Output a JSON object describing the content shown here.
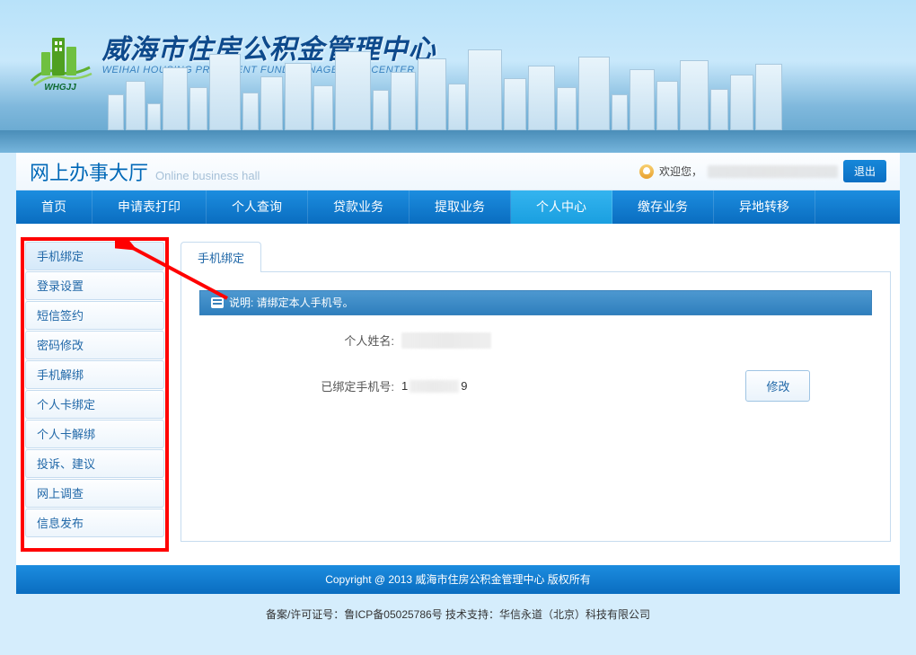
{
  "header": {
    "org_name_cn": "威海市住房公积金管理中心",
    "org_name_en": "WEIHAI HOUSING PROVIDENT FUND MANAGEMENT CENTER",
    "logo_code": "WHGJJ"
  },
  "title_bar": {
    "title_cn": "网上办事大厅",
    "title_en": "Online business hall",
    "welcome_text": "欢迎您，",
    "logout_label": "退出"
  },
  "nav": {
    "items": [
      {
        "label": "首页"
      },
      {
        "label": "申请表打印"
      },
      {
        "label": "个人查询"
      },
      {
        "label": "贷款业务"
      },
      {
        "label": "提取业务"
      },
      {
        "label": "个人中心"
      },
      {
        "label": "缴存业务"
      },
      {
        "label": "异地转移"
      }
    ],
    "active_index": 5
  },
  "sidebar": {
    "items": [
      {
        "label": "手机绑定"
      },
      {
        "label": "登录设置"
      },
      {
        "label": "短信签约"
      },
      {
        "label": "密码修改"
      },
      {
        "label": "手机解绑"
      },
      {
        "label": "个人卡绑定"
      },
      {
        "label": "个人卡解绑"
      },
      {
        "label": "投诉、建议"
      },
      {
        "label": "网上调查"
      },
      {
        "label": "信息发布"
      }
    ],
    "active_index": 0
  },
  "panel": {
    "tab_label": "手机绑定",
    "info_text": "说明: 请绑定本人手机号。",
    "name_label": "个人姓名:",
    "phone_label": "已绑定手机号:",
    "phone_prefix": "1",
    "phone_suffix": "9",
    "modify_button": "修改"
  },
  "footer": {
    "copyright": "Copyright @ 2013 威海市住房公积金管理中心 版权所有",
    "record_info": "备案/许可证号：鲁ICP备05025786号 技术支持：华信永道（北京）科技有限公司"
  }
}
